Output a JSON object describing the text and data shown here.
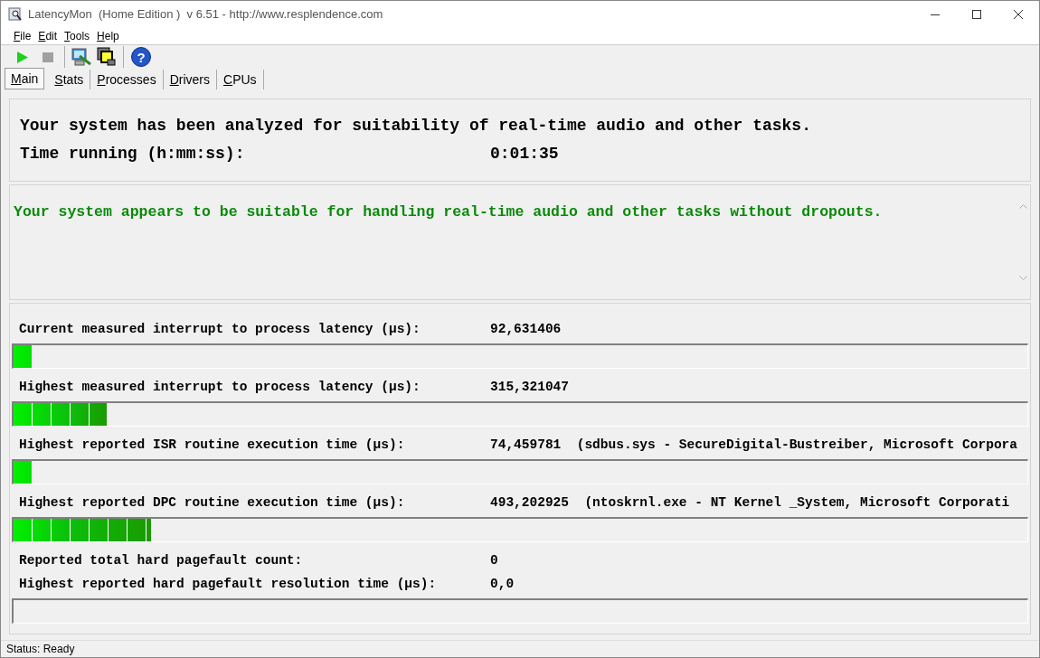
{
  "window": {
    "title": "LatencyMon  (Home Edition )  v 6.51 - http://www.resplendence.com"
  },
  "menu": [
    {
      "label": "File"
    },
    {
      "label": "Edit"
    },
    {
      "label": "Tools"
    },
    {
      "label": "Help"
    }
  ],
  "toolbar": [
    {
      "kind": "start",
      "disabled": false
    },
    {
      "kind": "stop",
      "disabled": true
    },
    {
      "kind": "monitor"
    },
    {
      "kind": "windows"
    },
    {
      "kind": "help",
      "glyph": "?"
    }
  ],
  "tabs": [
    {
      "label": "Main",
      "selected": true
    },
    {
      "label": "Stats",
      "selected": false
    },
    {
      "label": "Processes",
      "selected": false
    },
    {
      "label": "Drivers",
      "selected": false
    },
    {
      "label": "CPUs",
      "selected": false
    }
  ],
  "summary": {
    "analysis": "Your system has been analyzed for suitability of real-time audio and other tasks.",
    "time_label": "Time running (h:mm:ss):",
    "time_value": "0:01:35"
  },
  "verdict": {
    "text": "Your system appears to be suitable for handling real-time audio and other tasks without dropouts."
  },
  "measurements": [
    {
      "kind": "meter",
      "label": "Current measured interrupt to process latency (µs):",
      "value": "92,631406",
      "level": 0.018
    },
    {
      "kind": "meter",
      "label": "Highest measured interrupt to process latency (µs):",
      "value": "315,321047",
      "level": 0.092
    },
    {
      "kind": "meter",
      "label": "Highest reported ISR routine execution time (µs):",
      "value": "74,459781  (sdbus.sys - SecureDigital-Bustreiber, Microsoft Corpora",
      "level": 0.019
    },
    {
      "kind": "meter",
      "label": "Highest reported DPC routine execution time (µs):",
      "value": "493,202925  (ntoskrnl.exe - NT Kernel _System, Microsoft Corporati",
      "level": 0.136
    },
    {
      "kind": "plain",
      "label": "Reported total hard pagefault count:",
      "value": "0"
    },
    {
      "kind": "meter",
      "label": "Highest reported hard pagefault resolution time (µs):",
      "value": "0,0"
    }
  ],
  "status_bar": "Status: Ready"
}
